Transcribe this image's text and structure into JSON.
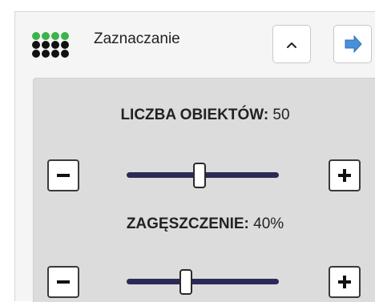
{
  "panel": {
    "title": "Zaznaczanie",
    "icon": "dot-grid-icon",
    "collapse_icon": "chevron-up-icon",
    "next_icon": "arrow-right-icon"
  },
  "settings": {
    "count": {
      "label": "LICZBA OBIEKTÓW:",
      "value": "50",
      "slider_fraction": 0.48
    },
    "density": {
      "label": "ZAGĘSZCZENIE:",
      "value": "40%",
      "slider_fraction": 0.39
    }
  },
  "colors": {
    "dot_green": "#3cb34a",
    "dot_black": "#111111",
    "track": "#2b2a56",
    "arrow_blue": "#4a90d9"
  }
}
